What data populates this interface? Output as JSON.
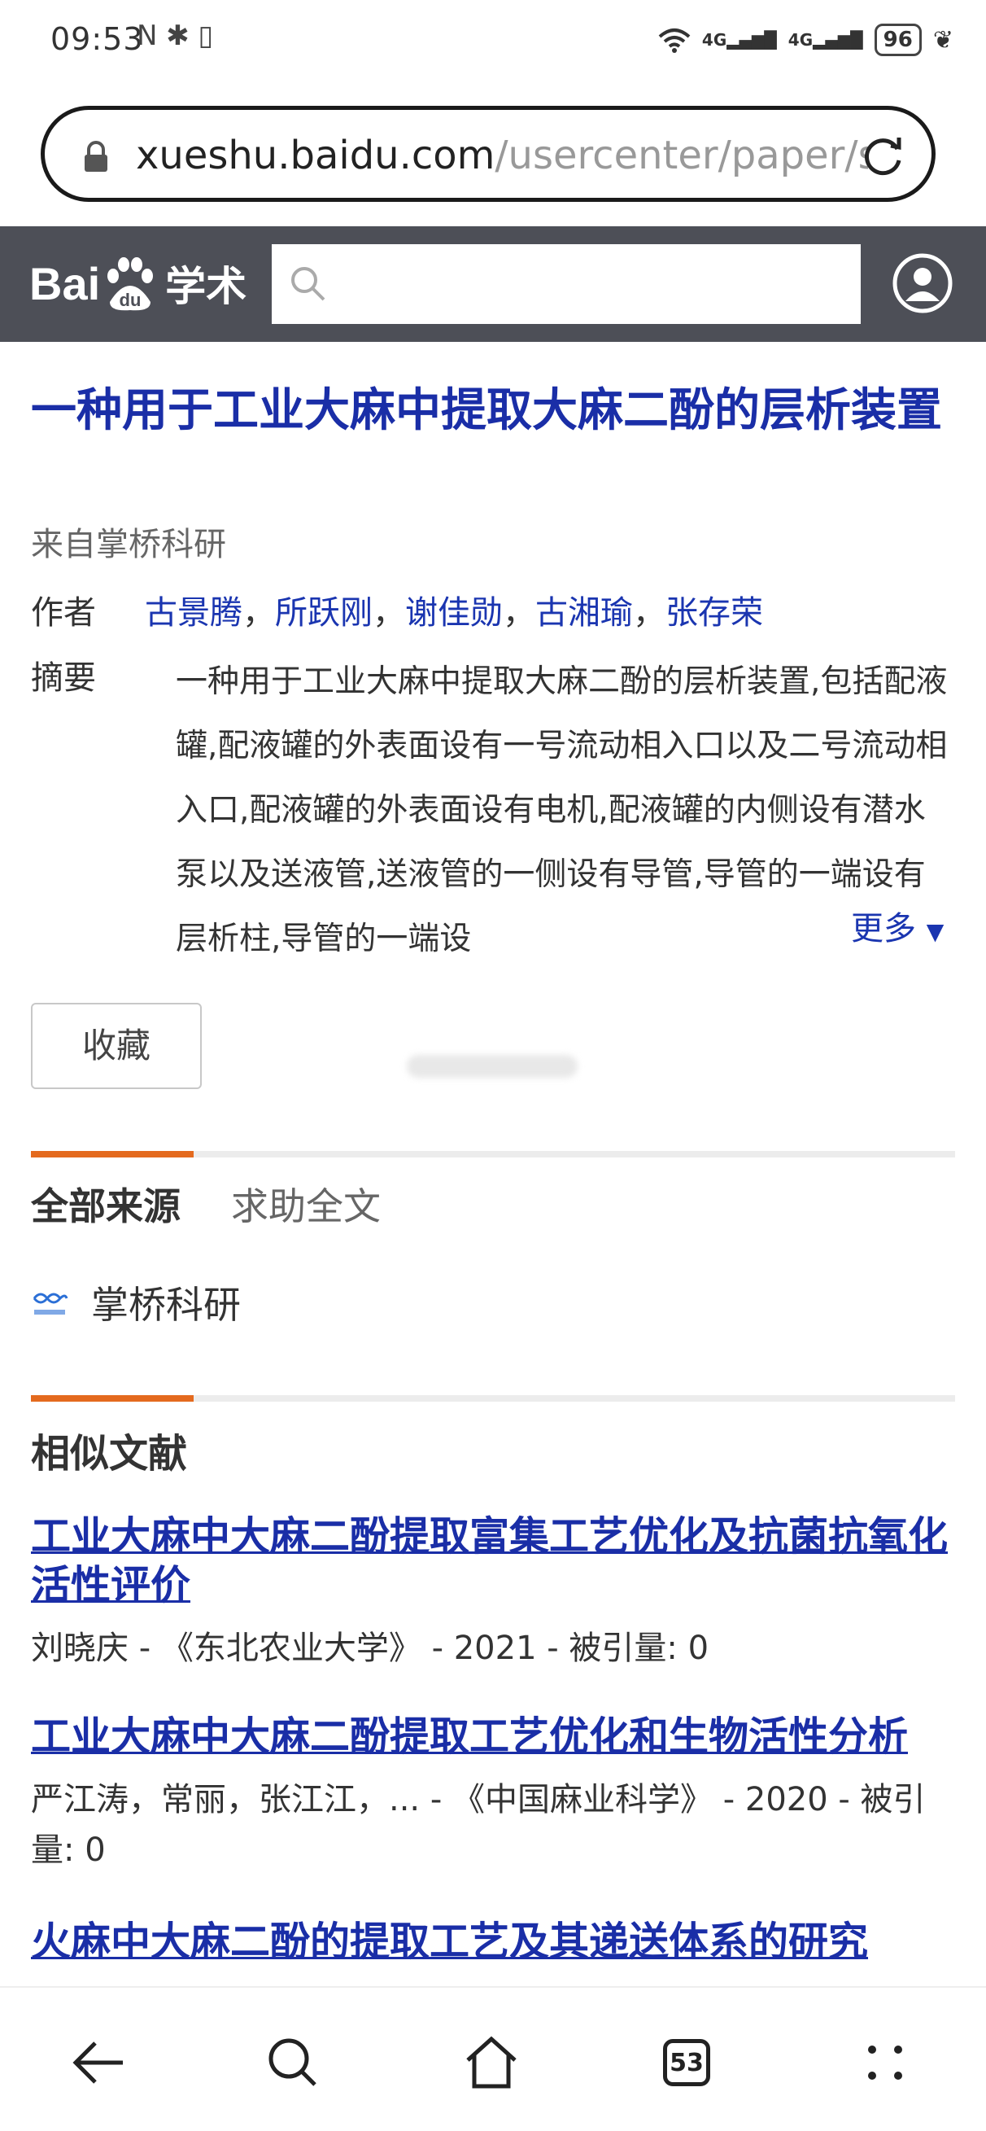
{
  "status_bar": {
    "time": "09:53",
    "left_icons": "N ✱ ▯",
    "signal_1": "4G",
    "signal_2": "4G",
    "battery": "96"
  },
  "browser": {
    "url_host": "xueshu.baidu.com",
    "url_path": "/usercenter/paper/s",
    "tabs_count": "53"
  },
  "header": {
    "logo_bai": "Bai",
    "logo_du": "du",
    "logo_product": "学术",
    "search_placeholder": ""
  },
  "paper": {
    "title": "一种用于工业大麻中提取大麻二酚的层析装置",
    "source": "来自掌桥科研",
    "authors_label": "作者",
    "authors": [
      "古景腾",
      "所跃刚",
      "谢佳勋",
      "古湘瑜",
      "张存荣"
    ],
    "abstract_label": "摘要",
    "abstract": "一种用于工业大麻中提取大麻二酚的层析装置,包括配液罐,配液罐的外表面设有一号流动相入口以及二号流动相入口,配液罐的外表面设有电机,配液罐的内侧设有潜水泵以及送液管,送液管的一侧设有导管,导管的一端设有层析柱,导管的一端设",
    "more_label": "更多",
    "collect_label": "收藏"
  },
  "sources": {
    "tab_all": "全部来源",
    "tab_help": "求助全文",
    "items": [
      {
        "name": "掌桥科研"
      }
    ]
  },
  "similar": {
    "heading": "相似文献",
    "items": [
      {
        "title": "工业大麻中大麻二酚提取富集工艺优化及抗菌抗氧化活性评价",
        "meta": "刘晓庆 - 《东北农业大学》 - 2021 - 被引量: 0"
      },
      {
        "title": "工业大麻中大麻二酚提取工艺优化和生物活性分析",
        "meta": "严江涛，常丽，张江江，... - 《中国麻业科学》 - 2020 - 被引量: 0"
      },
      {
        "title": "火麻中大麻二酚的提取工艺及其递送体系的研究",
        "meta": ""
      }
    ]
  },
  "colors": {
    "link_blue": "#1a2ea7",
    "header_bg": "#4d4f57",
    "accent_orange": "#e46a1e"
  }
}
